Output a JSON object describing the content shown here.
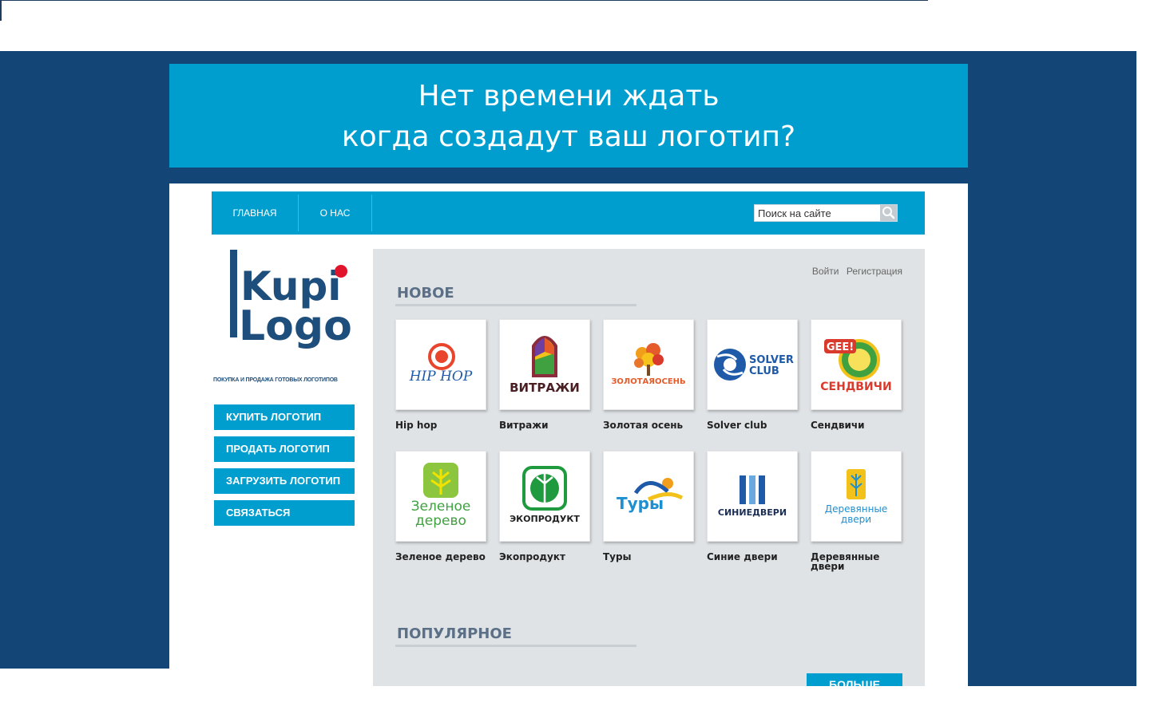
{
  "banner": {
    "line1": "Нет времени ждать",
    "line2": "когда создадут ваш логотип?"
  },
  "nav": {
    "items": [
      "ГЛАВНАЯ",
      "О НАС"
    ],
    "search_placeholder": "Поиск на сайте"
  },
  "logo": {
    "word1": "Kupi",
    "word2": "Logo",
    "tagline": "ПОКУПКА И ПРОДАЖА ГОТОВЫХ ЛОГОТИПОВ"
  },
  "sidebar": {
    "buttons": [
      "КУПИТЬ ЛОГОТИП",
      "ПРОДАТЬ ЛОГОТИП",
      "ЗАГРУЗИТЬ ЛОГОТИП",
      "СВЯЗАТЬСЯ"
    ]
  },
  "auth": {
    "login": "Войти",
    "register": "Регистрация"
  },
  "sections": {
    "new": "НОВОЕ",
    "popular": "ПОПУЛЯРНОЕ"
  },
  "products": [
    {
      "name": "Hip hop",
      "logo_text": "HIP HOP"
    },
    {
      "name": "Витражи",
      "logo_text": "ВИТРАЖИ"
    },
    {
      "name": "Золотая осень",
      "logo_text": "ЗОЛОТАЯОСЕНЬ"
    },
    {
      "name": "Solver club",
      "logo_text": "SOLVER",
      "logo_text2": "CLUB"
    },
    {
      "name": "Сендвичи",
      "logo_text": "СЕНДВИЧИ",
      "logo_text2": "GEE!"
    },
    {
      "name": "Зеленое дерево",
      "logo_text": "Зеленое",
      "logo_text2": "дерево"
    },
    {
      "name": "Экопродукт",
      "logo_text": "ЭКОПРОДУКТ"
    },
    {
      "name": "Туры",
      "logo_text": "Туры"
    },
    {
      "name": "Синие двери",
      "logo_text": "СИНИЕДВЕРИ"
    },
    {
      "name": "Деревянные двери",
      "logo_text": "Деревянные",
      "logo_text2": "двери"
    }
  ],
  "more_button": "БОЛЬШЕ",
  "colors": {
    "dark_bg": "#134676",
    "accent": "#009ecf",
    "panel": "#dfe3e6"
  }
}
